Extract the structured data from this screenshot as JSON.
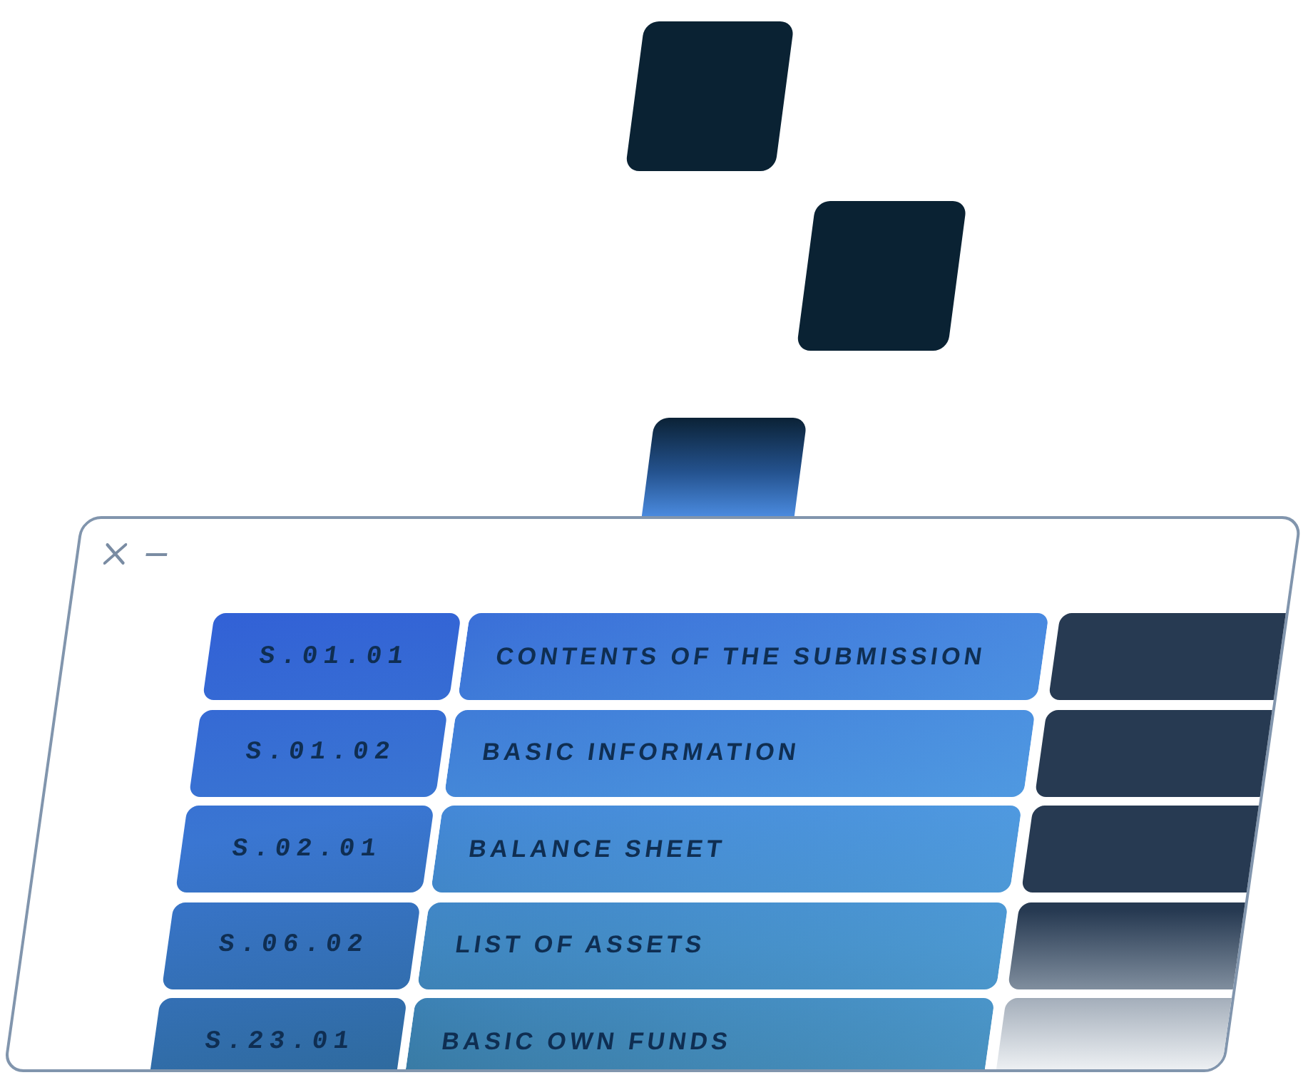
{
  "table": {
    "rows": [
      {
        "code": "S.01.01",
        "title": "CONTENTS OF THE SUBMISSION"
      },
      {
        "code": "S.01.02",
        "title": "BASIC INFORMATION"
      },
      {
        "code": "S.02.01",
        "title": "BALANCE SHEET"
      },
      {
        "code": "S.06.02",
        "title": "LIST OF ASSETS"
      },
      {
        "code": "S.23.01",
        "title": "BASIC OWN FUNDS"
      }
    ]
  }
}
